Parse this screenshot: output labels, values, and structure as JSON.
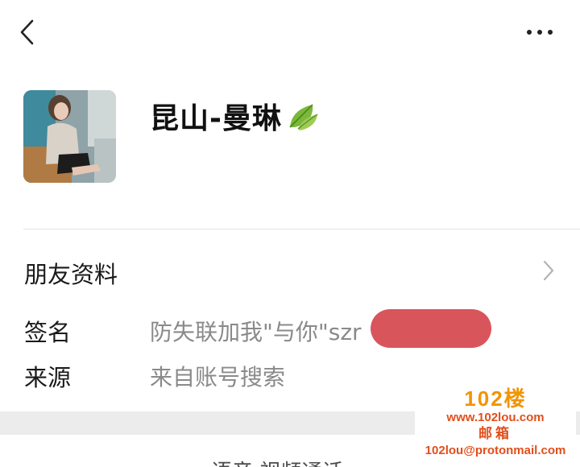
{
  "header": {
    "back_icon": "chevron-left-icon",
    "more_icon": "more-horizontal-icon"
  },
  "profile": {
    "nickname": "昆山-曼琳",
    "leaf_icon": "leaf-emoji-icon"
  },
  "friend_info": {
    "label": "朋友资料"
  },
  "signature": {
    "label": "签名",
    "value": "防失联加我\"与你\"szr"
  },
  "source": {
    "label": "来源",
    "value": "来自账号搜索"
  },
  "bottom": {
    "partial_text": "语音·视频通话"
  },
  "watermark": {
    "brand": "102楼",
    "site": "www.102lou.com",
    "mail_title": "邮箱",
    "mail": "102lou@protonmail.com"
  },
  "colors": {
    "redaction": "#d9555c",
    "watermark_orange": "#f29400",
    "watermark_red": "#e24e1b"
  }
}
